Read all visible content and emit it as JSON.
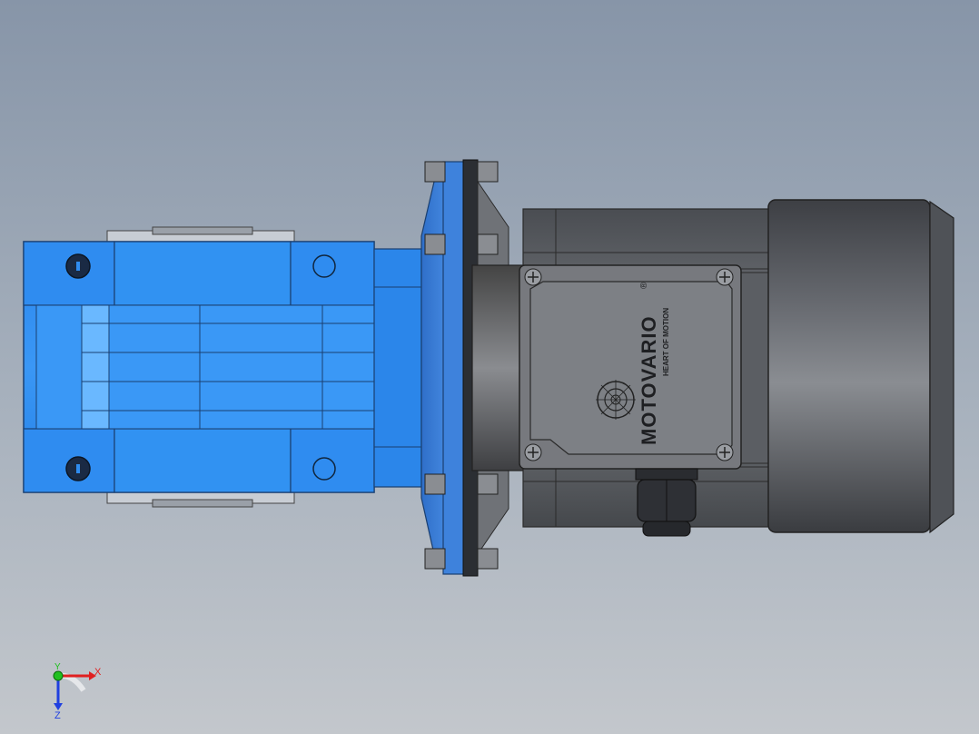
{
  "viewport": {
    "background_top": "#8795a8",
    "background_bottom": "#c3c7cc"
  },
  "model": {
    "gearbox_color": "#2f8cf0",
    "flange_color": "#3a7bd5",
    "motor_color": "#55585e",
    "terminal_box_color": "#6a6d72"
  },
  "branding": {
    "logo_text": "MOTOVARIO",
    "registered_mark": "®",
    "tagline": "HEART OF MOTION"
  },
  "triad": {
    "x_label": "X",
    "y_label": "Y",
    "z_label": "Z",
    "x_color": "#e02020",
    "y_color": "#20c020",
    "z_color": "#2040e0"
  }
}
